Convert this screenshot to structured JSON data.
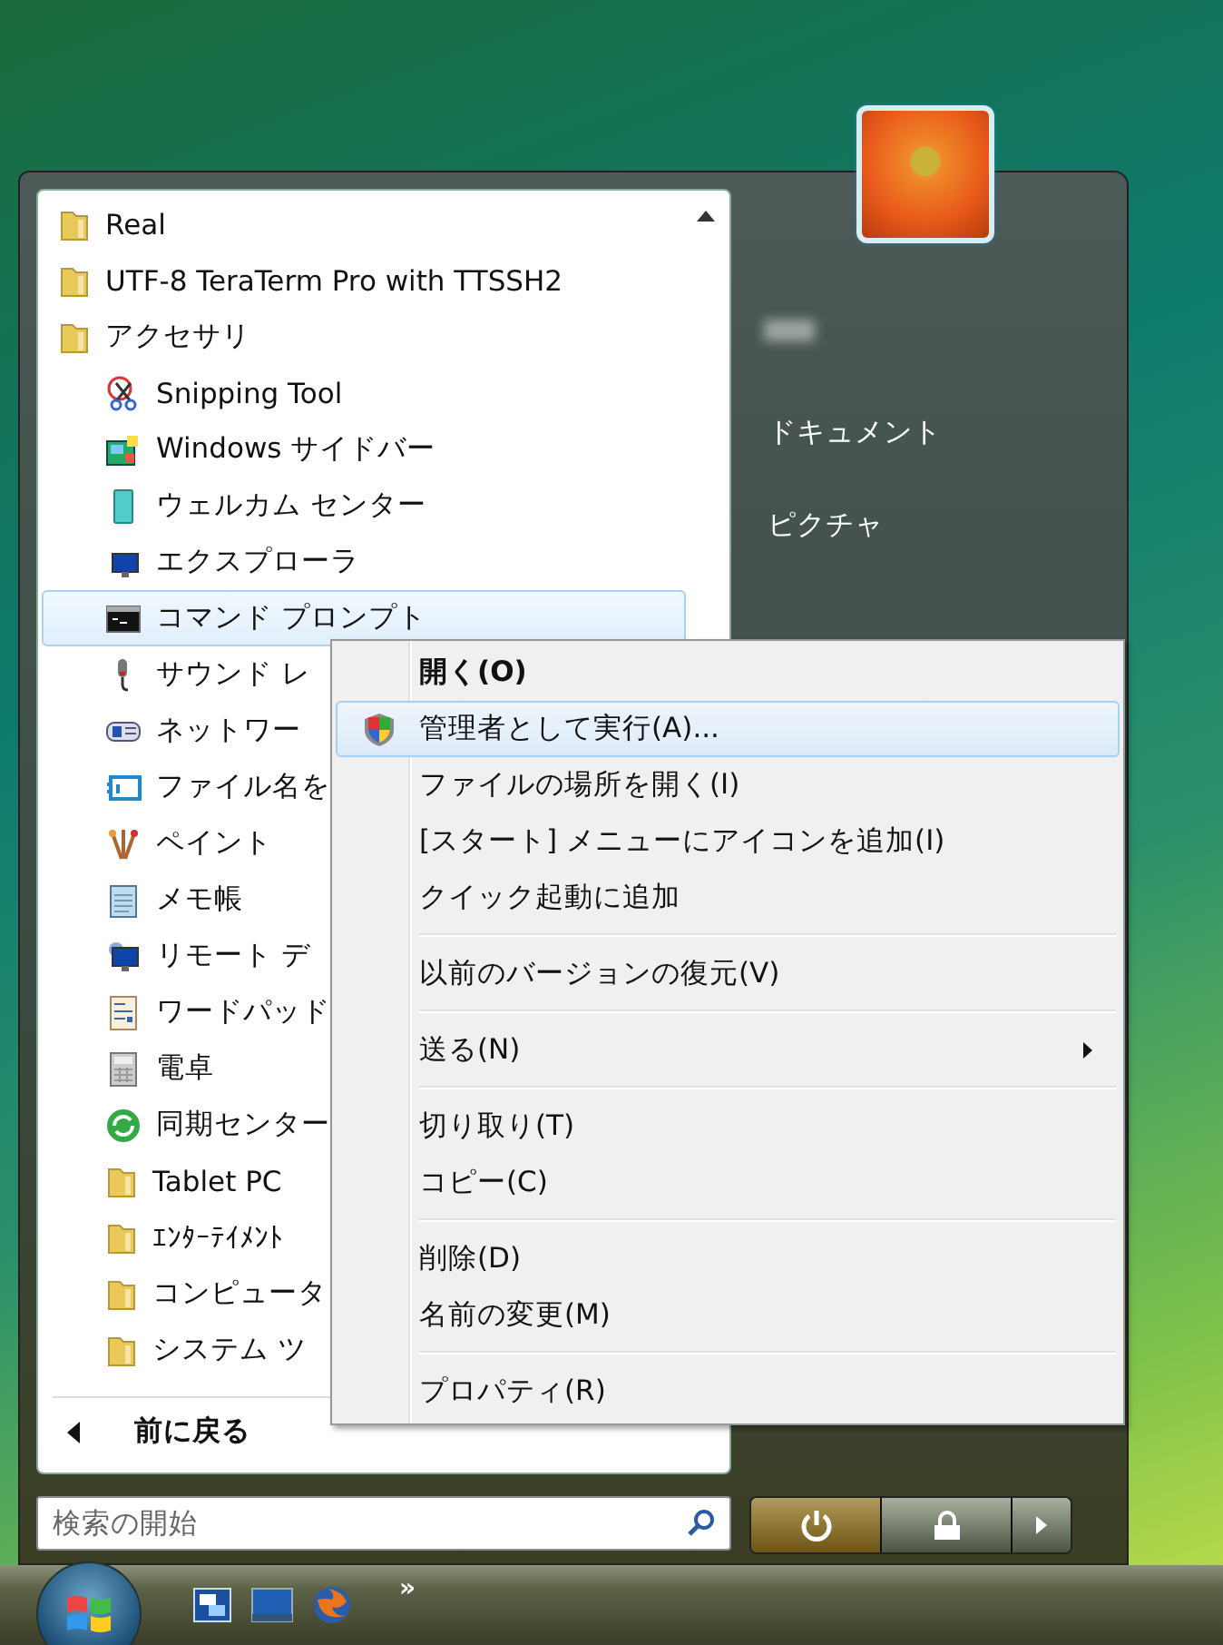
{
  "start_menu": {
    "programs": [
      {
        "label": "Real",
        "kind": "folder",
        "selected": false
      },
      {
        "label": "UTF-8 TeraTerm Pro with TTSSH2",
        "kind": "folder",
        "selected": false
      },
      {
        "label": "アクセサリ",
        "kind": "folder",
        "selected": false,
        "children": [
          {
            "label": "Snipping Tool",
            "kind": "program",
            "selected": false
          },
          {
            "label": "Windows サイドバー",
            "kind": "program",
            "selected": false
          },
          {
            "label": "ウェルカム センター",
            "kind": "program",
            "selected": false
          },
          {
            "label": "エクスプローラ",
            "kind": "program",
            "selected": false
          },
          {
            "label": "コマンド プロンプト",
            "kind": "program",
            "selected": true
          },
          {
            "label": "サウンド レ",
            "kind": "program",
            "selected": false
          },
          {
            "label": "ネットワー",
            "kind": "program",
            "selected": false
          },
          {
            "label": "ファイル名を",
            "kind": "program",
            "selected": false
          },
          {
            "label": "ペイント",
            "kind": "program",
            "selected": false
          },
          {
            "label": "メモ帳",
            "kind": "program",
            "selected": false
          },
          {
            "label": "リモート デ",
            "kind": "program",
            "selected": false
          },
          {
            "label": "ワードパッド",
            "kind": "program",
            "selected": false
          },
          {
            "label": "電卓",
            "kind": "program",
            "selected": false
          },
          {
            "label": "同期センター",
            "kind": "program",
            "selected": false
          },
          {
            "label": "Tablet PC",
            "kind": "folder",
            "selected": false
          },
          {
            "label": "ｴﾝﾀｰﾃｲﾒﾝﾄ",
            "kind": "folder",
            "selected": false
          },
          {
            "label": "コンピュータ",
            "kind": "folder",
            "selected": false
          },
          {
            "label": "システム ツ",
            "kind": "folder",
            "selected": false
          }
        ]
      }
    ],
    "back_button": {
      "label": "前に戻る"
    },
    "search": {
      "placeholder": "検索の開始"
    },
    "places": [
      {
        "label": "ドキュメント"
      },
      {
        "label": "ピクチャ"
      }
    ]
  },
  "context_menu": {
    "items": [
      {
        "kind": "command",
        "label": "開く(O)",
        "default": true,
        "elevated": false,
        "selected": false
      },
      {
        "kind": "command",
        "label": "管理者として実行(A)...",
        "default": false,
        "elevated": true,
        "selected": true
      },
      {
        "kind": "command",
        "label": "ファイルの場所を開く(I)",
        "default": false,
        "elevated": false,
        "selected": false
      },
      {
        "kind": "command",
        "label": "[スタート] メニューにアイコンを追加(I)",
        "default": false,
        "elevated": false,
        "selected": false
      },
      {
        "kind": "command",
        "label": "クイック起動に追加",
        "default": false,
        "elevated": false,
        "selected": false
      },
      {
        "kind": "separator"
      },
      {
        "kind": "command",
        "label": "以前のバージョンの復元(V)",
        "default": false,
        "elevated": false,
        "selected": false
      },
      {
        "kind": "separator"
      },
      {
        "kind": "submenu",
        "label": "送る(N)",
        "default": false,
        "elevated": false,
        "selected": false
      },
      {
        "kind": "separator"
      },
      {
        "kind": "command",
        "label": "切り取り(T)",
        "default": false,
        "elevated": false,
        "selected": false
      },
      {
        "kind": "command",
        "label": "コピー(C)",
        "default": false,
        "elevated": false,
        "selected": false
      },
      {
        "kind": "separator"
      },
      {
        "kind": "command",
        "label": "削除(D)",
        "default": false,
        "elevated": false,
        "selected": false
      },
      {
        "kind": "command",
        "label": "名前の変更(M)",
        "default": false,
        "elevated": false,
        "selected": false
      },
      {
        "kind": "separator"
      },
      {
        "kind": "command",
        "label": "プロパティ(R)",
        "default": false,
        "elevated": false,
        "selected": false
      }
    ]
  },
  "taskbar": {
    "overflow": "»"
  }
}
